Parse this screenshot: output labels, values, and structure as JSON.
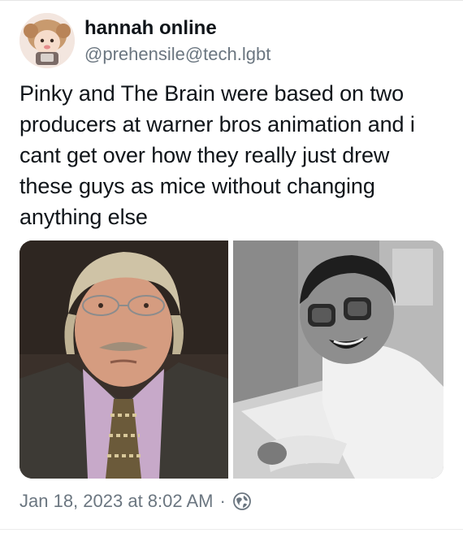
{
  "author": {
    "display_name": "hannah online",
    "handle": "@prehensile@tech.lgbt",
    "avatar_icon": "cartoon-avatar-icon"
  },
  "post": {
    "text": "Pinky and The Brain were based on two producers at warner bros animation and i cant get over how they really just drew these guys as mice without changing anything else",
    "images": [
      {
        "subject": "photo of man with gray hair, glasses and mustache"
      },
      {
        "subject": "black and white photo of smiling man with glasses at drawing desk"
      }
    ],
    "timestamp": "Jan 18, 2023 at 8:02 AM",
    "separator": "·",
    "visibility_icon": "globe-icon"
  },
  "colors": {
    "text": "#0f1419",
    "secondary": "#6b7680"
  }
}
